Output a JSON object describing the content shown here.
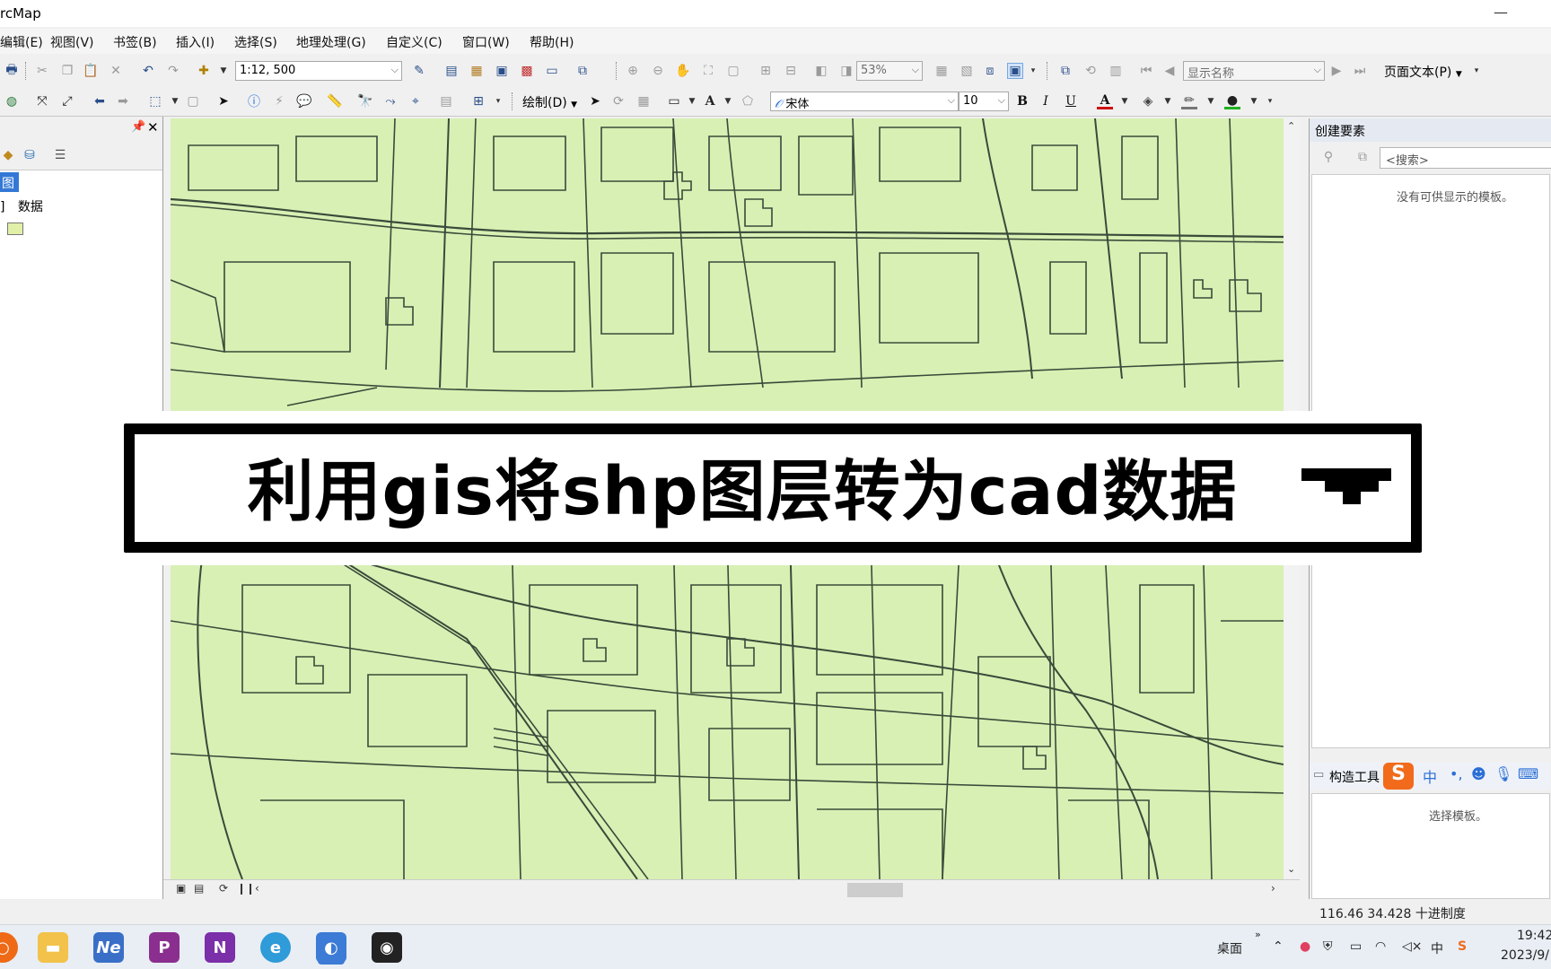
{
  "window": {
    "title": "rcMap",
    "minimize_glyph": "—"
  },
  "menu": {
    "items": [
      "编辑(E)",
      "视图(V)",
      "书签(B)",
      "插入(I)",
      "选择(S)",
      "地理处理(G)",
      "自定义(C)",
      "窗口(W)",
      "帮助(H)"
    ]
  },
  "toolbar": {
    "scale_value": "1:12, 500",
    "zoom_value": "53%",
    "display_name_placeholder": "显示名称",
    "page_text_label": "页面文本(P)",
    "draw_label": "绘制(D)",
    "font_name": "宋体",
    "font_size": "10",
    "bold_label": "B",
    "italic_label": "I",
    "underline_label": "U",
    "font_color_label": "A",
    "text_label": "A"
  },
  "toc": {
    "layers_label": "图层",
    "data_frame_label": "数据"
  },
  "right_panel": {
    "title": "创建要素",
    "search_placeholder": "<搜索>",
    "no_templates_msg": "没有可供显示的模板。",
    "construct_tools_label": "构造工具",
    "choose_template_msg": "选择模板。",
    "ime_cn_label": "中"
  },
  "status": {
    "coords": "116.46  34.428 十进制度"
  },
  "taskbar": {
    "desktop_label": "桌面",
    "time": "19:42",
    "date": "2023/9/"
  },
  "overlay": {
    "title": "利用gis将shp图层转为cad数据"
  },
  "colors": {
    "map_fill": "#d8f0b4",
    "map_lines": "#3a4a3a",
    "selection_blue": "#3478d6"
  }
}
